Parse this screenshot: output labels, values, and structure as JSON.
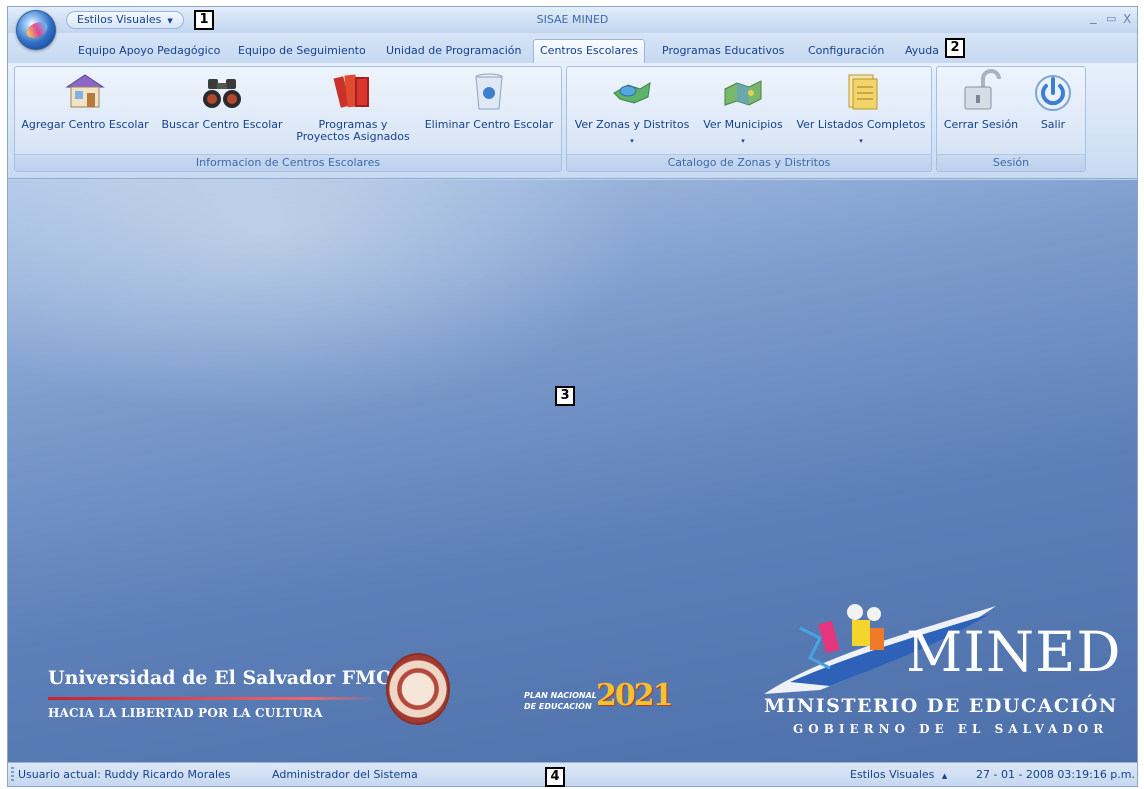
{
  "window": {
    "title": "SISAE MINED"
  },
  "quick_access": {
    "label": "Estilos Visuales"
  },
  "tabs": [
    {
      "label": "Equipo Apoyo Pedagógico"
    },
    {
      "label": "Equipo de Seguimiento"
    },
    {
      "label": "Unidad de Programación"
    },
    {
      "label": "Centros Escolares",
      "active": true
    },
    {
      "label": "Programas  Educativos"
    },
    {
      "label": "Configuración"
    },
    {
      "label": "Ayuda"
    }
  ],
  "ribbon": {
    "groups": [
      {
        "caption": "Informacion de Centros Escolares",
        "buttons": [
          {
            "label": "Agregar Centro Escolar",
            "icon": "school-building-icon"
          },
          {
            "label": "Buscar Centro Escolar",
            "icon": "binoculars-icon"
          },
          {
            "label": "Programas y",
            "label2": "Proyectos Asignados",
            "icon": "books-icon"
          },
          {
            "label": "Eliminar Centro Escolar",
            "icon": "recycle-bin-icon"
          }
        ]
      },
      {
        "caption": "Catalogo de Zonas y Distritos",
        "buttons": [
          {
            "label": "Ver Zonas y Distritos",
            "icon": "map-zones-icon",
            "dropdown": "▾"
          },
          {
            "label": "Ver Municipios",
            "icon": "map-icon",
            "dropdown": "▾"
          },
          {
            "label": "Ver Listados Completos",
            "icon": "folder-list-icon",
            "dropdown": "▾"
          }
        ]
      },
      {
        "caption": "Sesión",
        "buttons": [
          {
            "label": "Cerrar Sesión",
            "icon": "padlock-open-icon"
          },
          {
            "label": "Salir",
            "icon": "power-icon"
          }
        ]
      }
    ]
  },
  "main": {
    "ues_title": "Universidad de El Salvador  FMO",
    "ues_motto": "HACIA LA LIBERTAD POR LA CULTURA",
    "plan_line1": "PLAN NACIONAL",
    "plan_line2": "DE EDUCACIÓN",
    "plan_year": "2021",
    "mined_word": "MINED",
    "mined_sub1": "MINISTERIO DE EDUCACIÓN",
    "mined_sub2": "GOBIERNO DE EL SALVADOR"
  },
  "markers": [
    "1",
    "2",
    "3",
    "4"
  ],
  "statusbar": {
    "user": "Usuario actual:  Ruddy Ricardo Morales",
    "role": "Administrador del Sistema",
    "styles": "Estilos Visuales",
    "styles_arrow": "▲",
    "datetime": "27 - 01 - 2008  03:19:16 p.m."
  },
  "window_controls": {
    "minimize": "_",
    "maximize": "▭",
    "close": "X"
  },
  "colors": {
    "accent": "#15428b",
    "ribbon_bg": "#d6e4f6",
    "main_bg": "#5d7fb8"
  }
}
